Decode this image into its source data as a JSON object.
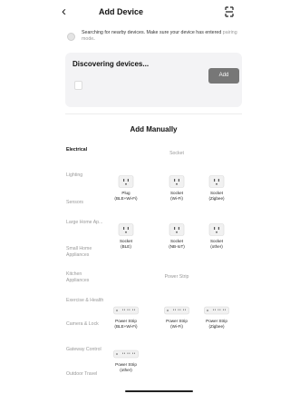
{
  "header": {
    "title": "Add Device",
    "back_icon": "‹"
  },
  "search": {
    "text": "Searching for nearby devices. Make sure your device has entered ",
    "link": "pairing mode",
    "end": "."
  },
  "discover": {
    "title": "Discovering devices...",
    "add_label": "Add"
  },
  "manual": {
    "title": "Add Manually"
  },
  "categories": [
    "Electrical",
    "Lighting",
    "Sensors",
    "Large Home Ap...",
    "Small Home Appliances",
    "Kitchen Appliances",
    "Exercise & Health",
    "Camera & Lock",
    "Gateway Control",
    "Outdoor Travel"
  ],
  "groups": {
    "socket": "Socket",
    "power_strip": "Power Strip"
  },
  "devices": {
    "socket_row1": [
      {
        "line1": "Plug",
        "line2": "(BLE+Wi-Fi)"
      },
      {
        "line1": "Socket",
        "line2": "(Wi-Fi)"
      },
      {
        "line1": "Socket",
        "line2": "(Zigbee)"
      }
    ],
    "socket_row2": [
      {
        "line1": "Socket",
        "line2": "(BLE)"
      },
      {
        "line1": "Socket",
        "line2": "(NB-IoT)"
      },
      {
        "line1": "Socket",
        "line2": "(other)"
      }
    ],
    "strip_row1": [
      {
        "line1": "Power Strip",
        "line2": "(BLE+Wi-Fi)"
      },
      {
        "line1": "Power Strip",
        "line2": "(Wi-Fi)"
      },
      {
        "line1": "Power Strip",
        "line2": "(Zigbee)"
      }
    ],
    "strip_row2": [
      {
        "line1": "Power Strip",
        "line2": "(other)"
      }
    ]
  }
}
